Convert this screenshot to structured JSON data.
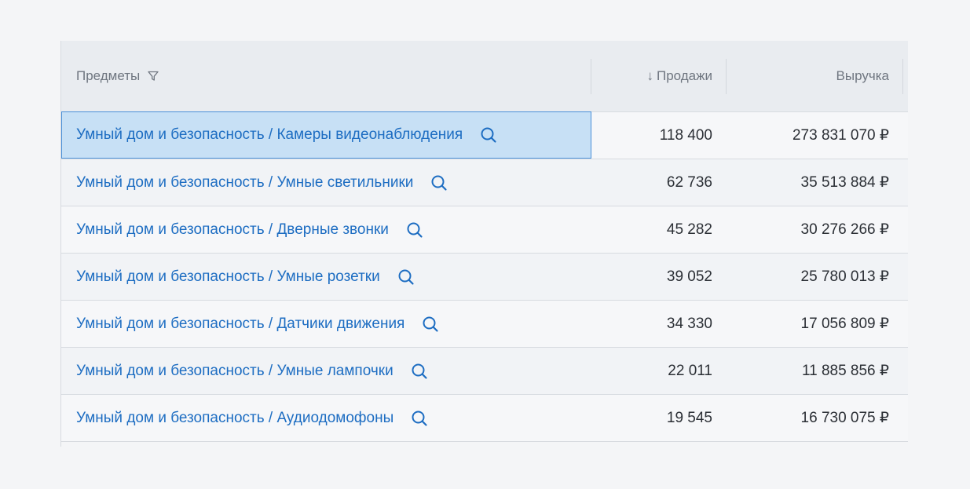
{
  "table": {
    "columns": {
      "subject": "Предметы",
      "sales_arrow": "↓",
      "sales": "Продажи",
      "revenue": "Выручка"
    },
    "rows": [
      {
        "subject": "Умный дом и безопасность / Камеры видеонаблюдения",
        "sales": "118 400",
        "revenue": "273 831 070 ₽",
        "selected": true
      },
      {
        "subject": "Умный дом и безопасность / Умные светильники",
        "sales": "62 736",
        "revenue": "35 513 884 ₽"
      },
      {
        "subject": "Умный дом и безопасность / Дверные звонки",
        "sales": "45 282",
        "revenue": "30 276 266 ₽"
      },
      {
        "subject": "Умный дом и безопасность / Умные розетки",
        "sales": "39 052",
        "revenue": "25 780 013 ₽"
      },
      {
        "subject": "Умный дом и безопасность / Датчики движения",
        "sales": "34 330",
        "revenue": "17 056 809 ₽"
      },
      {
        "subject": "Умный дом и безопасность / Умные лампочки",
        "sales": "22 011",
        "revenue": "11 885 856 ₽"
      },
      {
        "subject": "Умный дом и безопасность / Аудиодомофоны",
        "sales": "19 545",
        "revenue": "16 730 075 ₽"
      }
    ]
  },
  "icons": {
    "filter": "filter-icon",
    "search": "search-icon",
    "sort": "arrow-down-icon"
  },
  "colors": {
    "link": "#1d6dc2",
    "selected_bg": "#c7e0f5",
    "selected_border": "#4a90d9",
    "header_bg": "#e9ecf0"
  }
}
